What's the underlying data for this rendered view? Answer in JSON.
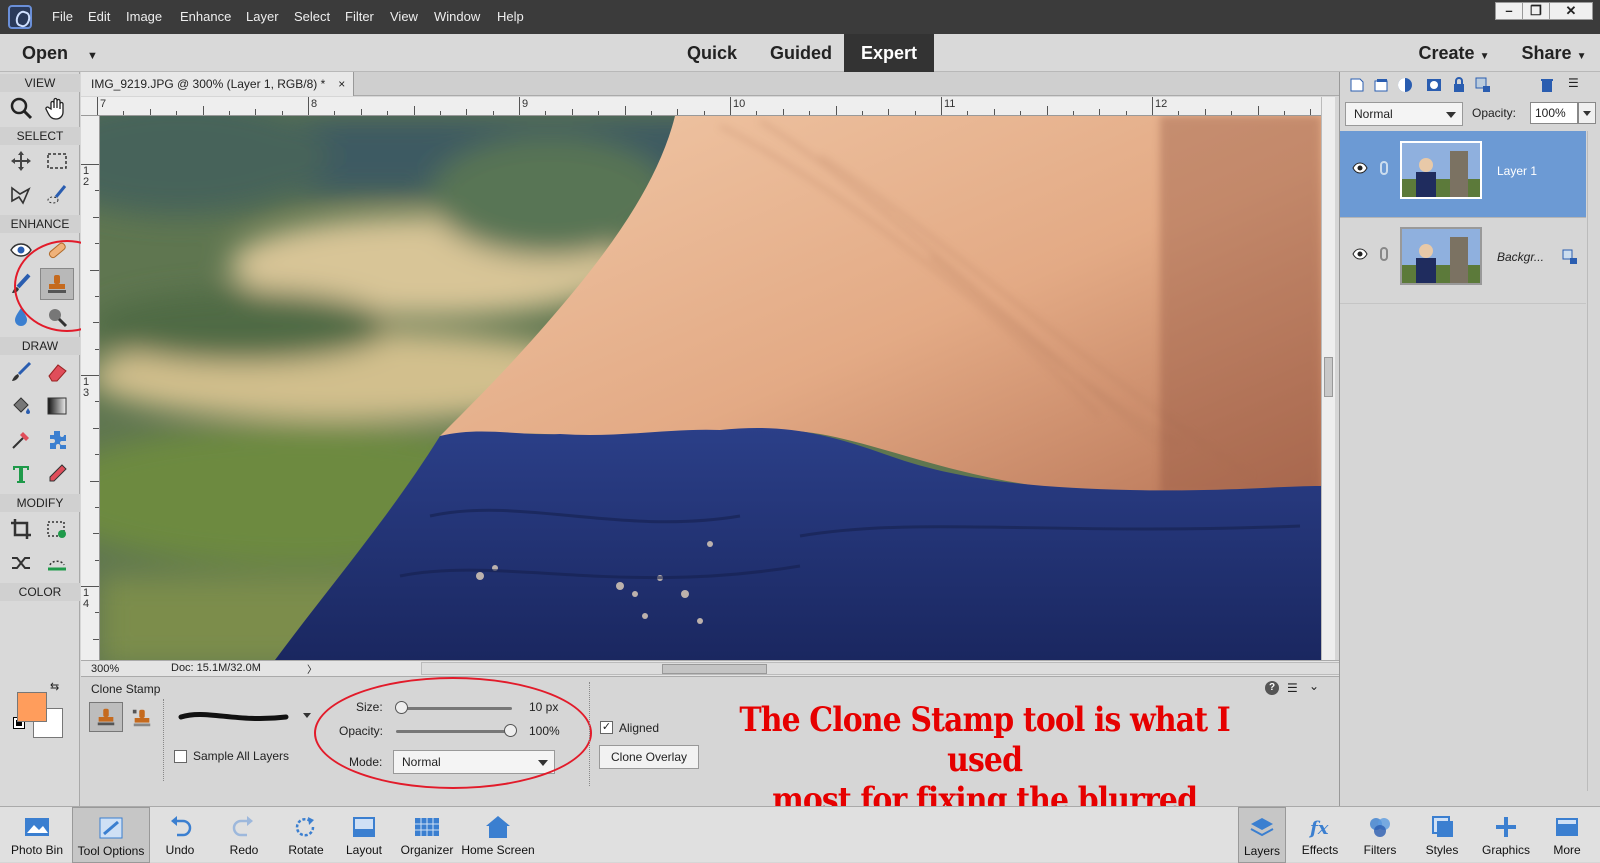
{
  "menubar": {
    "items": [
      "File",
      "Edit",
      "Image",
      "Enhance",
      "Layer",
      "Select",
      "Filter",
      "View",
      "Window",
      "Help"
    ]
  },
  "modebar": {
    "open_label": "Open",
    "tabs": [
      "Quick",
      "Guided",
      "Expert"
    ],
    "create_label": "Create",
    "share_label": "Share"
  },
  "toolbox": {
    "sections": {
      "view": "VIEW",
      "select": "SELECT",
      "enhance": "ENHANCE",
      "draw": "DRAW",
      "modify": "MODIFY",
      "color": "COLOR"
    },
    "foreground_color": "#ff9d5c",
    "background_color": "#ffffff",
    "selected_tool": "clone-stamp"
  },
  "document": {
    "tab_title": "IMG_9219.JPG @ 300% (Layer 1, RGB/8) *",
    "close_glyph": "×",
    "ruler_h_labels": [
      "7",
      "8",
      "9",
      "10",
      "11",
      "12"
    ],
    "ruler_v_labels": [
      "1\n2",
      "1\n3",
      "1\n4"
    ],
    "zoom": "300%",
    "doc_info": "Doc: 15.1M/32.0M"
  },
  "tool_options": {
    "tool_name": "Clone Stamp",
    "size_label": "Size:",
    "size_value": "10 px",
    "size_fraction": 0.0,
    "opacity_label": "Opacity:",
    "opacity_value": "100%",
    "opacity_fraction": 1.0,
    "mode_label": "Mode:",
    "mode_value": "Normal",
    "sample_all_layers_label": "Sample All Layers",
    "sample_all_layers_checked": false,
    "aligned_label": "Aligned",
    "aligned_checked": true,
    "clone_overlay_label": "Clone Overlay"
  },
  "annotation": {
    "line1": "The Clone Stamp tool is what I used",
    "line2": "most for fixing the blurred spots.",
    "color": "#e60000"
  },
  "layers_panel": {
    "blend_mode": "Normal",
    "opacity_label": "Opacity:",
    "opacity_value": "100%",
    "layers": [
      {
        "name": "Layer 1",
        "selected": true
      },
      {
        "name": "Backgr...",
        "selected": false,
        "locked": true
      }
    ]
  },
  "taskbar": {
    "left": [
      "Photo Bin",
      "Tool Options",
      "Undo",
      "Redo",
      "Rotate",
      "Layout",
      "Organizer",
      "Home Screen"
    ],
    "right": [
      "Layers",
      "Effects",
      "Filters",
      "Styles",
      "Graphics",
      "More"
    ]
  }
}
